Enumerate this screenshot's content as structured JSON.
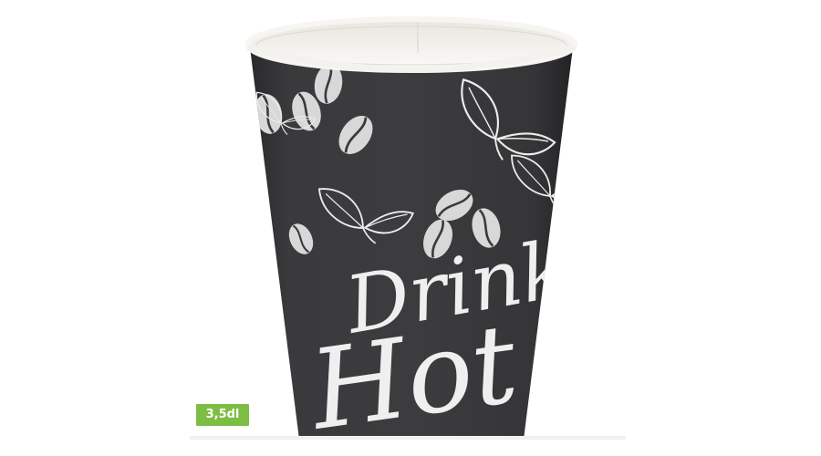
{
  "product": {
    "image_alt": "Paper coffee cup with coffee beans and leaves print",
    "print_text_line1": "Drinks",
    "print_text_line2": "Hot",
    "size_badge": "3,5dl"
  },
  "colors": {
    "badge_bg": "#7cbd43",
    "cup_body": "#37373a",
    "print": "#e9e9e9"
  }
}
